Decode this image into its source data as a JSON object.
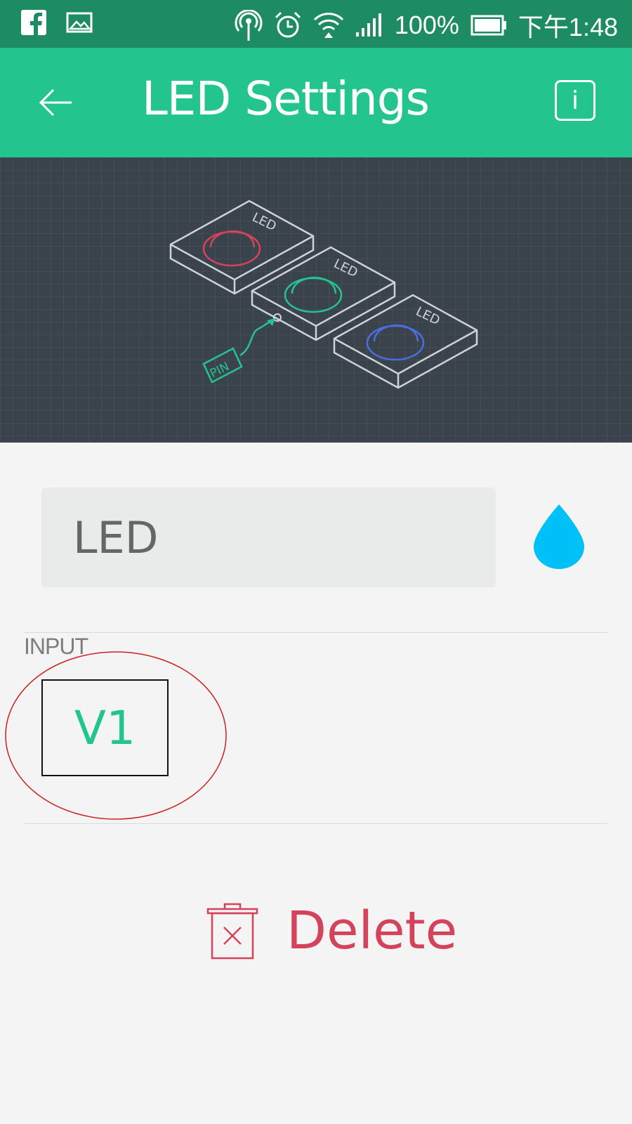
{
  "status_bar": {
    "battery": "100%",
    "time": "下午1:48",
    "icons": [
      "facebook-icon",
      "image-icon",
      "hotspot-icon",
      "alarm-icon",
      "wifi-icon",
      "signal-icon",
      "battery-icon"
    ]
  },
  "app_bar": {
    "title": "LED Settings",
    "info_label": "i"
  },
  "hero": {
    "led_labels": [
      "LED",
      "LED",
      "LED"
    ],
    "pin_label": "PIN",
    "led_colors": [
      "#d3435c",
      "#23c48e",
      "#4a6ee0"
    ]
  },
  "widget": {
    "name_value": "LED",
    "color": "#00c0f8"
  },
  "input": {
    "label": "INPUT",
    "pin_value": "V1"
  },
  "actions": {
    "delete_label": "Delete"
  },
  "colors": {
    "status_bar": "#1e8c62",
    "app_bar": "#23c48e",
    "delete": "#d3435c",
    "annotation": "#cc2020"
  }
}
